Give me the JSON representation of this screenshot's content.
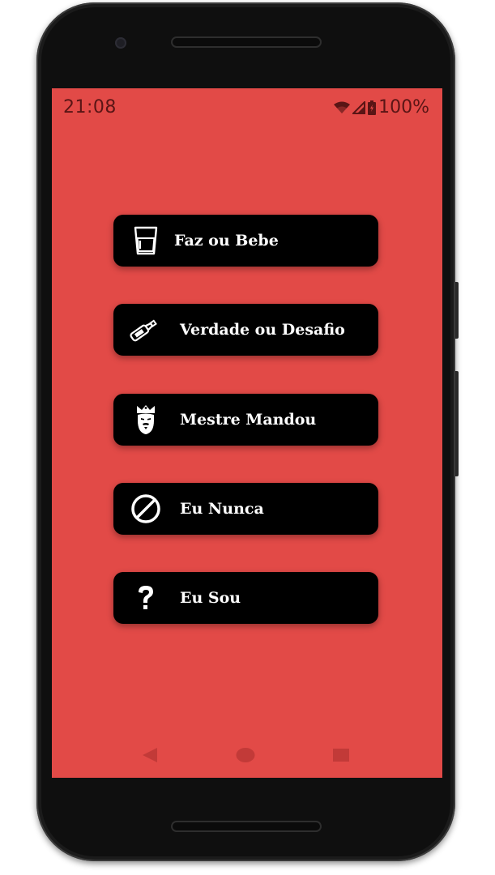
{
  "status_bar": {
    "time": "21:08",
    "battery": "100%",
    "icons": [
      "wifi-icon",
      "cell-signal-icon",
      "battery-icon"
    ]
  },
  "menu": {
    "items": [
      {
        "label": "Faz ou Bebe",
        "icon": "glass-icon"
      },
      {
        "label": "Verdade ou Desafio",
        "icon": "bottle-icon"
      },
      {
        "label": "Mestre Mandou",
        "icon": "king-icon"
      },
      {
        "label": "Eu Nunca",
        "icon": "prohibited-icon"
      },
      {
        "label": "Eu Sou",
        "icon": "question-icon"
      }
    ]
  },
  "navigation": {
    "items": [
      "back-icon",
      "home-icon",
      "recents-icon"
    ]
  },
  "colors": {
    "screen_background": "#e24a47",
    "button_background": "#000000",
    "button_text": "#ffffff",
    "status_text": "#5a1515",
    "nav_icon": "#c23a38"
  }
}
